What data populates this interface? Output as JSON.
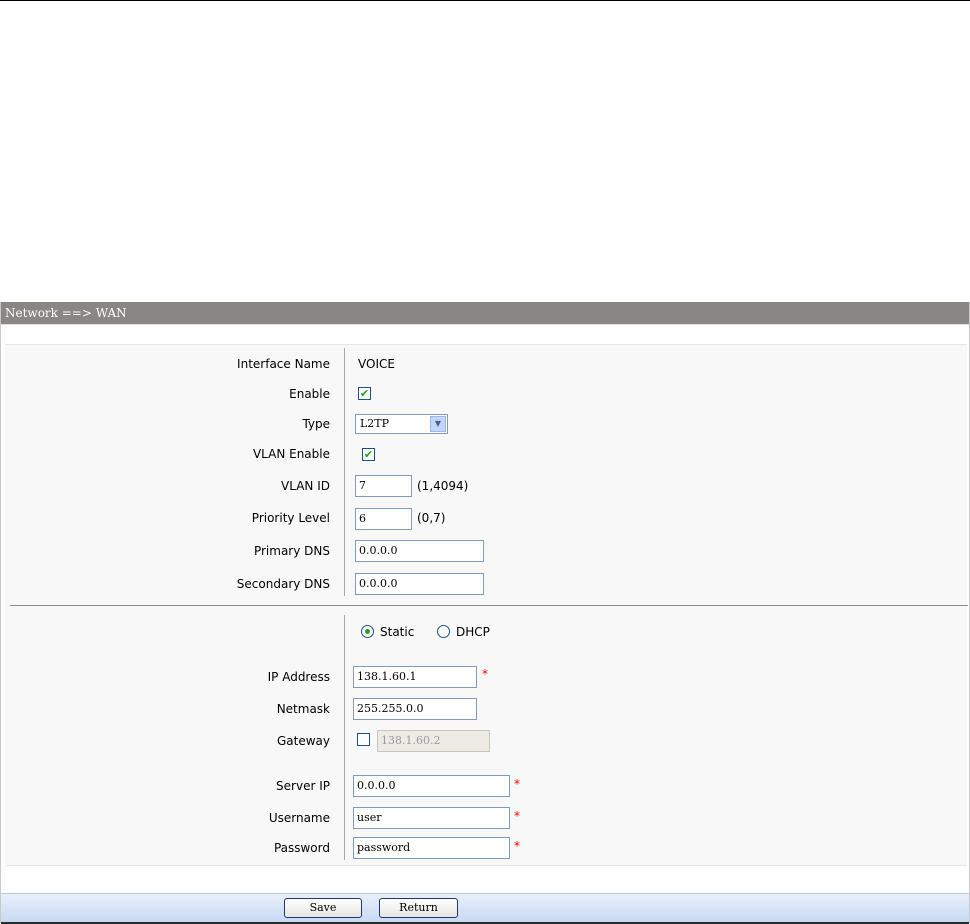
{
  "header": {
    "title": "Network ==> WAN"
  },
  "interface": {
    "name_label": "Interface Name",
    "name_value": "VOICE",
    "enable_label": "Enable",
    "enable_checked": "✔",
    "type_label": "Type",
    "type_value": "L2TP",
    "vlan_enable_label": "VLAN Enable",
    "vlan_enable_checked": "✔",
    "vlan_id_label": "VLAN ID",
    "vlan_id_value": "7",
    "vlan_id_range": "(1,4094)",
    "priority_label": "Priority Level",
    "priority_value": "6",
    "priority_range": "(0,7)",
    "primary_dns_label": "Primary DNS",
    "primary_dns_value": "0.0.0.0",
    "secondary_dns_label": "Secondary DNS",
    "secondary_dns_value": "0.0.0.0"
  },
  "addressing": {
    "static_label": "Static",
    "dhcp_label": "DHCP",
    "ip_label": "IP Address",
    "ip_value": "138.1.60.1",
    "netmask_label": "Netmask",
    "netmask_value": "255.255.0.0",
    "gateway_label": "Gateway",
    "gateway_value": "138.1.60.2"
  },
  "l2tp": {
    "server_ip_label": "Server IP",
    "server_ip_value": "0.0.0.0",
    "username_label": "Username",
    "username_value": "user",
    "password_label": "Password",
    "password_value": "password"
  },
  "required_mark": "*",
  "icons": {
    "dropdown": "chevron-down-icon",
    "check": "check-icon"
  },
  "colors": {
    "title_bar": "#8a8683",
    "footer": "#c7d9f3",
    "check": "#21a121",
    "required": "#ff0000"
  },
  "buttons": {
    "save": "Save",
    "return": "Return"
  }
}
